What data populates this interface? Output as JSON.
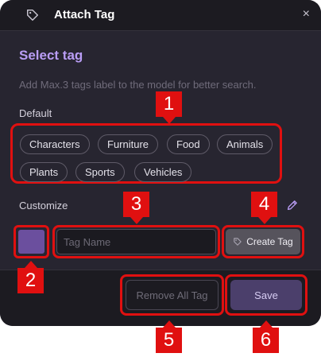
{
  "header": {
    "title": "Attach Tag",
    "close_icon": "×"
  },
  "select_tag": {
    "title": "Select tag",
    "description": "Add Max.3 tags label to the model for better search."
  },
  "default_tags": {
    "label": "Default",
    "chips": [
      "Characters",
      "Furniture",
      "Food",
      "Animals",
      "Plants",
      "Sports",
      "Vehicles"
    ]
  },
  "customize": {
    "label": "Customize",
    "color": "#6b4f9e",
    "name_input": {
      "value": "",
      "placeholder": "Tag Name"
    },
    "create_button": "Create Tag"
  },
  "footer": {
    "remove_all_button": "Remove All Tag",
    "save_button": "Save"
  },
  "annotations": [
    "1",
    "2",
    "3",
    "4",
    "5",
    "6"
  ],
  "colors": {
    "accent": "#b99df5",
    "highlight": "#e01010",
    "dialog_bg": "#272530"
  },
  "icons": {
    "header": "tag-icon",
    "close": "close-icon",
    "edit": "pencil-icon",
    "create": "tag-outline-icon"
  }
}
